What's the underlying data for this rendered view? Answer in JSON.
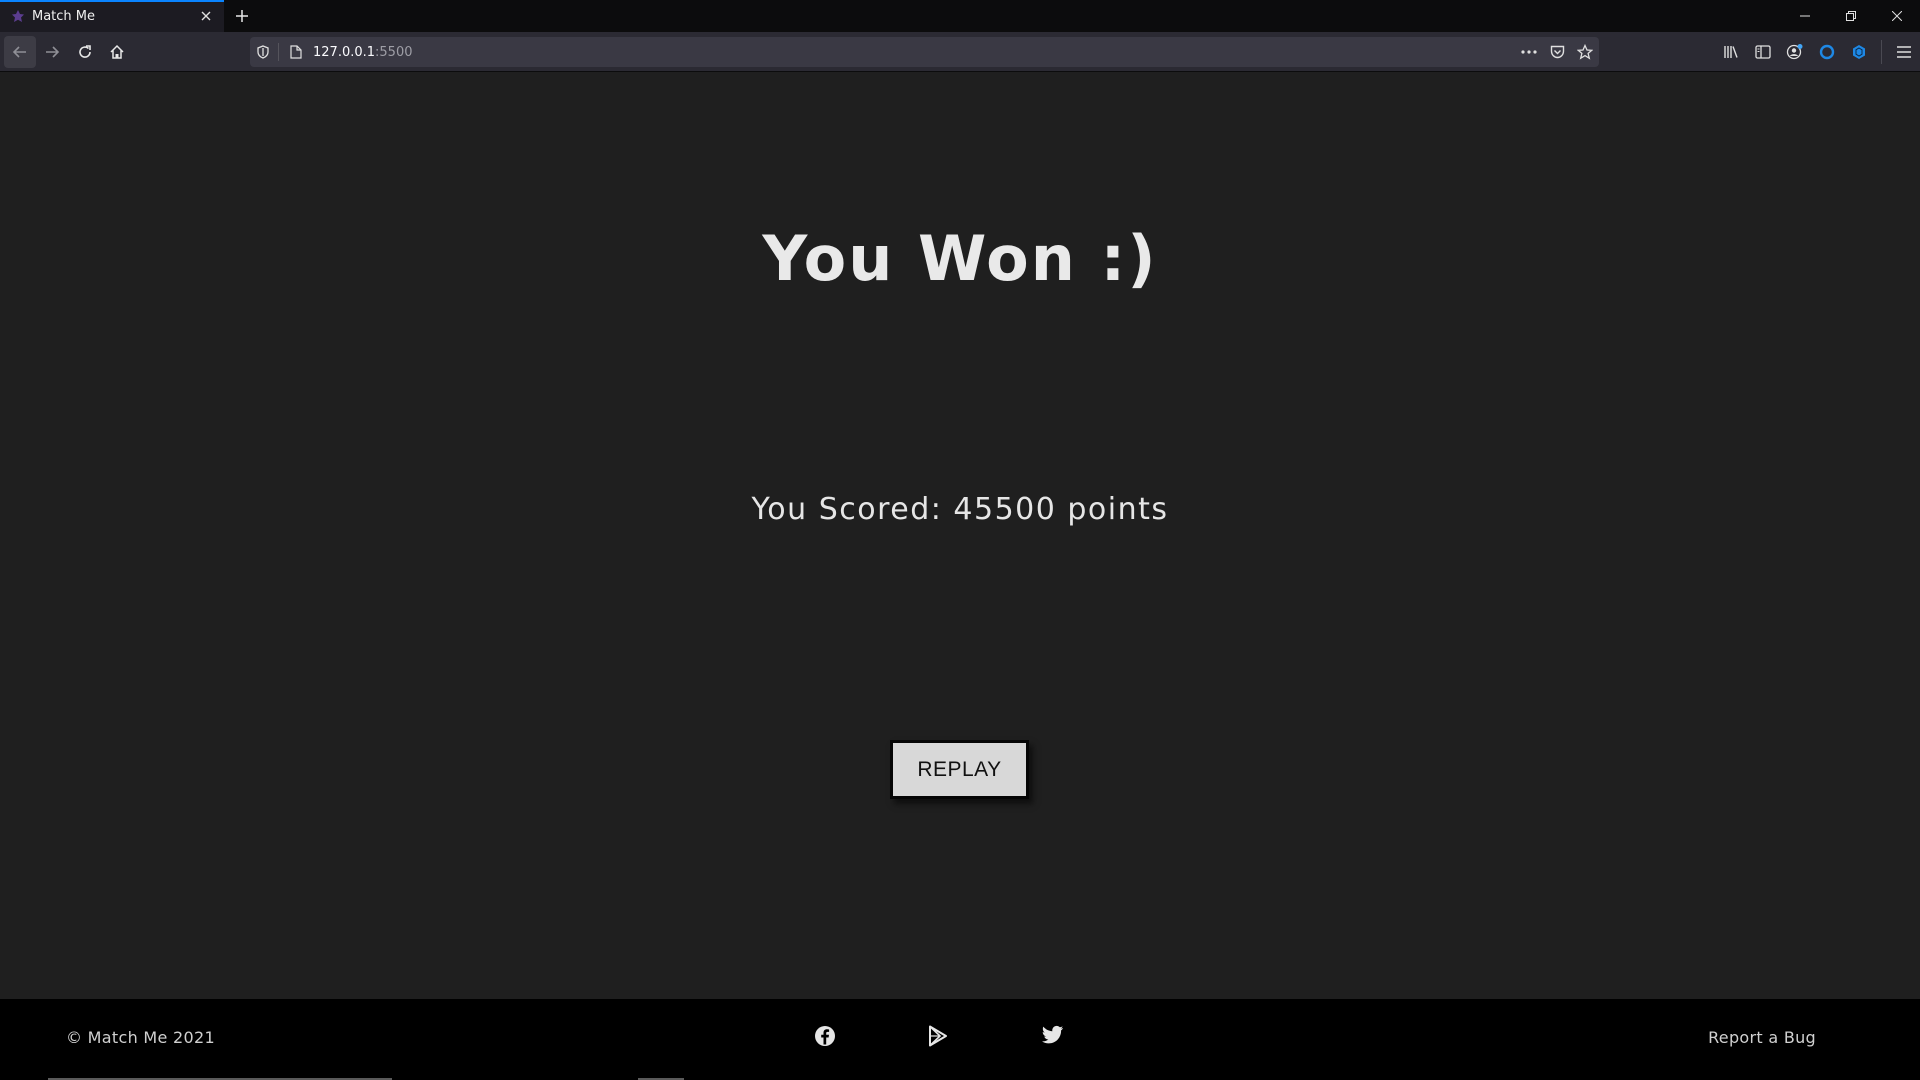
{
  "browser": {
    "tab_title": "Match Me",
    "url_host": "127.0.0.1",
    "url_port": ":5500"
  },
  "game": {
    "result_heading": "You Won :)",
    "score_text": "You Scored: 45500 points",
    "replay_label": "REPLAY"
  },
  "footer": {
    "copyright": "© Match Me 2021",
    "report_bug": "Report a Bug",
    "social_icons": [
      "facebook-icon",
      "google-play-icon",
      "twitter-icon"
    ]
  },
  "colors": {
    "page_background": "#1f1f1f",
    "footer_background": "#000000",
    "button_background": "#d8d8d8",
    "tab_accent": "#0a84ff"
  }
}
